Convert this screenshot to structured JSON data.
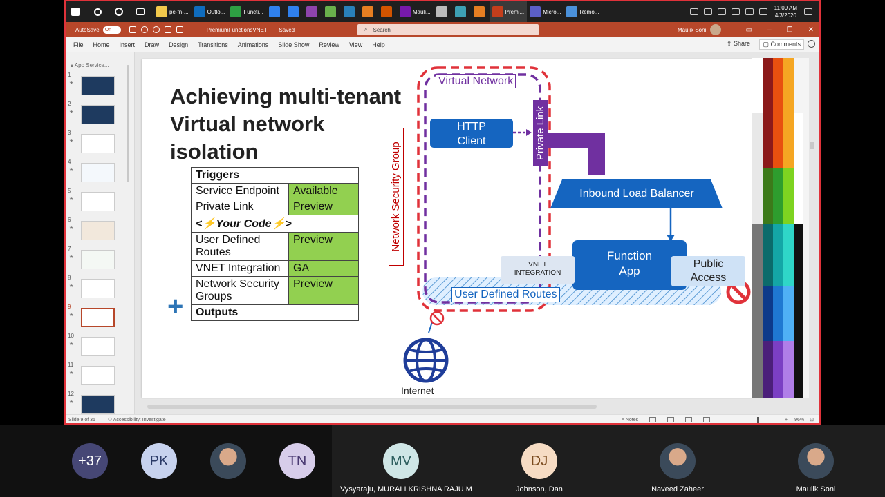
{
  "taskbar": {
    "apps": [
      {
        "label": "pe-fn-...",
        "color": "#f2c94c"
      },
      {
        "label": "Outlo...",
        "color": "#0f6cbd"
      },
      {
        "label": "Functi...",
        "color": "#2ea043"
      },
      {
        "label": "",
        "color": "#2f80ed"
      },
      {
        "label": "",
        "color": "#2f80ed"
      },
      {
        "label": "",
        "color": "#8e44ad"
      },
      {
        "label": "",
        "color": "#6ab04c"
      },
      {
        "label": "",
        "color": "#2980b9"
      },
      {
        "label": "",
        "color": "#e67e22"
      },
      {
        "label": "",
        "color": "#d35400"
      },
      {
        "label": "Mauli...",
        "color": "#7719aa"
      },
      {
        "label": "",
        "color": "#bbbbbb"
      },
      {
        "label": "",
        "color": "#3da0b4"
      },
      {
        "label": "",
        "color": "#e67e22"
      },
      {
        "label": "Premi...",
        "color": "#c43e1c",
        "active": true
      },
      {
        "label": "Micro...",
        "color": "#5b5fc7"
      },
      {
        "label": "Remo...",
        "color": "#4a90d9"
      }
    ],
    "time": "11:09 AM",
    "date": "4/3/2020"
  },
  "titlebar": {
    "autosave_label": "AutoSave",
    "autosave_state": "On",
    "doc_title": "PremiumFunctionsVNET",
    "saved": "Saved",
    "search_placeholder": "Search",
    "user_name": "Maulik Soni"
  },
  "menu": {
    "items": [
      "File",
      "Home",
      "Insert",
      "Draw",
      "Design",
      "Transitions",
      "Animations",
      "Slide Show",
      "Review",
      "View",
      "Help"
    ],
    "share": "Share",
    "comments": "Comments"
  },
  "thumbs": {
    "section": "App Service...",
    "items": [
      {
        "num": "1",
        "bg": "#1e3a5f"
      },
      {
        "num": "2",
        "bg": "#1e3a5f"
      },
      {
        "num": "3",
        "bg": "#ffffff"
      },
      {
        "num": "4",
        "bg": "#f4f8fc"
      },
      {
        "num": "5",
        "bg": "#ffffff"
      },
      {
        "num": "6",
        "bg": "#f2e8dc"
      },
      {
        "num": "7",
        "bg": "#f4f8f4"
      },
      {
        "num": "8",
        "bg": "#ffffff"
      },
      {
        "num": "9",
        "bg": "#ffffff"
      },
      {
        "num": "10",
        "bg": "#ffffff"
      },
      {
        "num": "11",
        "bg": "#ffffff"
      },
      {
        "num": "12",
        "bg": "#1e3a5f"
      }
    ]
  },
  "slide": {
    "title_lines": [
      "Achieving multi-tenant",
      "Virtual network",
      "isolation"
    ],
    "table": {
      "triggers": "Triggers",
      "rows": [
        {
          "feature": "Service Endpoint",
          "status": "Available"
        },
        {
          "feature": "Private Link",
          "status": "Preview"
        }
      ],
      "your_code": "<⚡Your Code⚡>",
      "rows2": [
        {
          "feature": "User Defined Routes",
          "status": "Preview"
        },
        {
          "feature": "VNET Integration",
          "status": "GA"
        },
        {
          "feature": "Network Security Groups",
          "status": "Preview"
        }
      ],
      "outputs": "Outputs"
    },
    "plus": "+",
    "diagram": {
      "virtual_network": "Virtual Network",
      "network_security_group": "Network Security Group",
      "private_link": "Private Link",
      "http_client": "HTTP Client",
      "inbound_lb": "Inbound Load Balancer",
      "function_app": "Function App",
      "vnet_integration": "VNET INTEGRATION",
      "public_access": "Public Access",
      "udr": "User Defined Routes",
      "internet": "Internet"
    }
  },
  "status": {
    "slide_of": "Slide 9 of 35",
    "accessibility": "Accessibility: Investigate",
    "notes": "Notes",
    "zoom": "96%"
  },
  "participants": [
    {
      "initials": "+37",
      "bg": "#464775",
      "fg": "#ffffff",
      "name": ""
    },
    {
      "initials": "PK",
      "bg": "#c7d2ee",
      "fg": "#2b3a67",
      "name": ""
    },
    {
      "initials": "",
      "photo": true,
      "name": ""
    },
    {
      "initials": "TN",
      "bg": "#d7cdea",
      "fg": "#4a3a72",
      "name": ""
    },
    {
      "initials": "MV",
      "bg": "#cfe6e6",
      "fg": "#2d5e5e",
      "name": "Vysyaraju, MURALI KRISHNA RAJU M"
    },
    {
      "initials": "DJ",
      "bg": "#f6dcc4",
      "fg": "#7a4a1e",
      "name": "Johnson, Dan"
    },
    {
      "initials": "",
      "photo": true,
      "name": "Naveed Zaheer"
    },
    {
      "initials": "",
      "photo": true,
      "name": "Maulik Soni"
    }
  ]
}
